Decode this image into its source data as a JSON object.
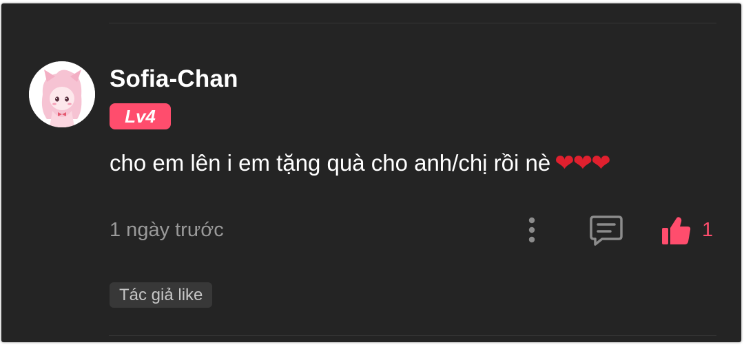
{
  "comment": {
    "username": "Sofia-Chan",
    "level": "Lv4",
    "text": "cho em lên i em tặng quà cho anh/chị rồi nè",
    "emoji": "❤❤❤",
    "timestamp": "1 ngày trước",
    "like_count": "1",
    "author_tag": "Tác giả like"
  },
  "icons": {
    "more": "more-vertical-icon",
    "reply": "comment-icon",
    "like": "thumbs-up-icon"
  },
  "colors": {
    "background": "#242424",
    "accent": "#ff4d6d",
    "muted_text": "#9a9a9a",
    "tag_background": "#383838"
  }
}
